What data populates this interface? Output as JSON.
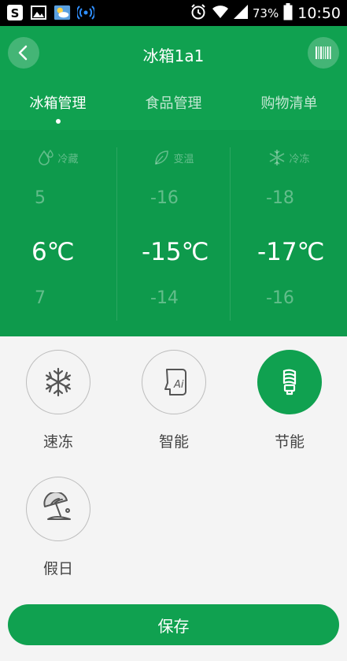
{
  "status_bar": {
    "battery": "73%",
    "time": "10:50"
  },
  "header": {
    "title": "冰箱1a1",
    "tabs": [
      {
        "label": "冰箱管理",
        "active": true
      },
      {
        "label": "食品管理",
        "active": false
      },
      {
        "label": "购物清单",
        "active": false
      }
    ]
  },
  "zones": [
    {
      "name": "冷藏",
      "icon": "water-drop-icon",
      "above": "5",
      "current": "6℃",
      "below": "7"
    },
    {
      "name": "变温",
      "icon": "leaf-icon",
      "above": "-16",
      "current": "-15℃",
      "below": "-14"
    },
    {
      "name": "冷冻",
      "icon": "snowflake-icon",
      "above": "-18",
      "current": "-17℃",
      "below": "-16"
    }
  ],
  "modes": [
    {
      "label": "速冻",
      "icon": "snowflake-icon",
      "active": false
    },
    {
      "label": "智能",
      "icon": "ai-head-icon",
      "active": false
    },
    {
      "label": "节能",
      "icon": "energy-bulb-icon",
      "active": true
    },
    {
      "label": "假日",
      "icon": "beach-umbrella-icon",
      "active": false
    }
  ],
  "save_label": "保存",
  "colors": {
    "primary": "#10a150",
    "panel": "#0e9a4c",
    "background": "#f4f4f4"
  }
}
